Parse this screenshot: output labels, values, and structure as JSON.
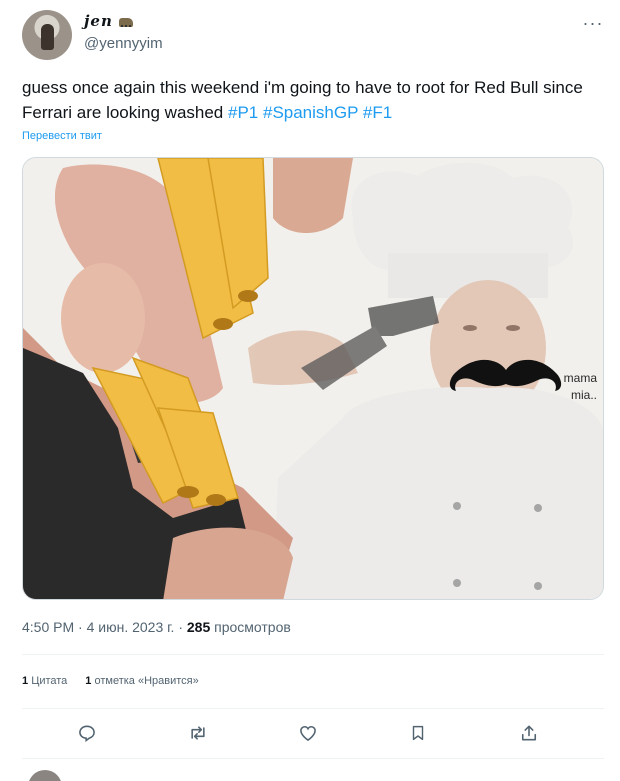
{
  "author": {
    "display_name": "jen",
    "handle": "@yennyyim",
    "avatar_icon": "user-avatar",
    "name_badge_icon": "truck-emoji"
  },
  "more_icon": "more-options-icon",
  "tweet": {
    "text_main": "guess once again this weekend i'm going to have to root for Red Bull since Ferrari are looking washed",
    "hashtags": [
      "#P1",
      "#SpanishGP",
      "#F1"
    ],
    "translate_label": "Перевести твит"
  },
  "media": {
    "caption": "mama mia..",
    "description_icon": "meme-image"
  },
  "meta": {
    "time": "4:50 PM",
    "separator": "·",
    "date": "4 июн. 2023 г.",
    "views_count": "285",
    "views_label": "просмотров"
  },
  "stats": {
    "quotes_count": "1",
    "quotes_label": "Цитата",
    "likes_count": "1",
    "likes_label": "отметка «Нравится»"
  },
  "actions": [
    {
      "name": "reply",
      "icon": "reply-icon"
    },
    {
      "name": "retweet",
      "icon": "retweet-icon"
    },
    {
      "name": "like",
      "icon": "heart-icon"
    },
    {
      "name": "bookmark",
      "icon": "bookmark-icon"
    },
    {
      "name": "share",
      "icon": "share-icon"
    }
  ],
  "colors": {
    "link": "#1d9bf0",
    "secondary_text": "#536471",
    "primary_text": "#0f1419"
  }
}
